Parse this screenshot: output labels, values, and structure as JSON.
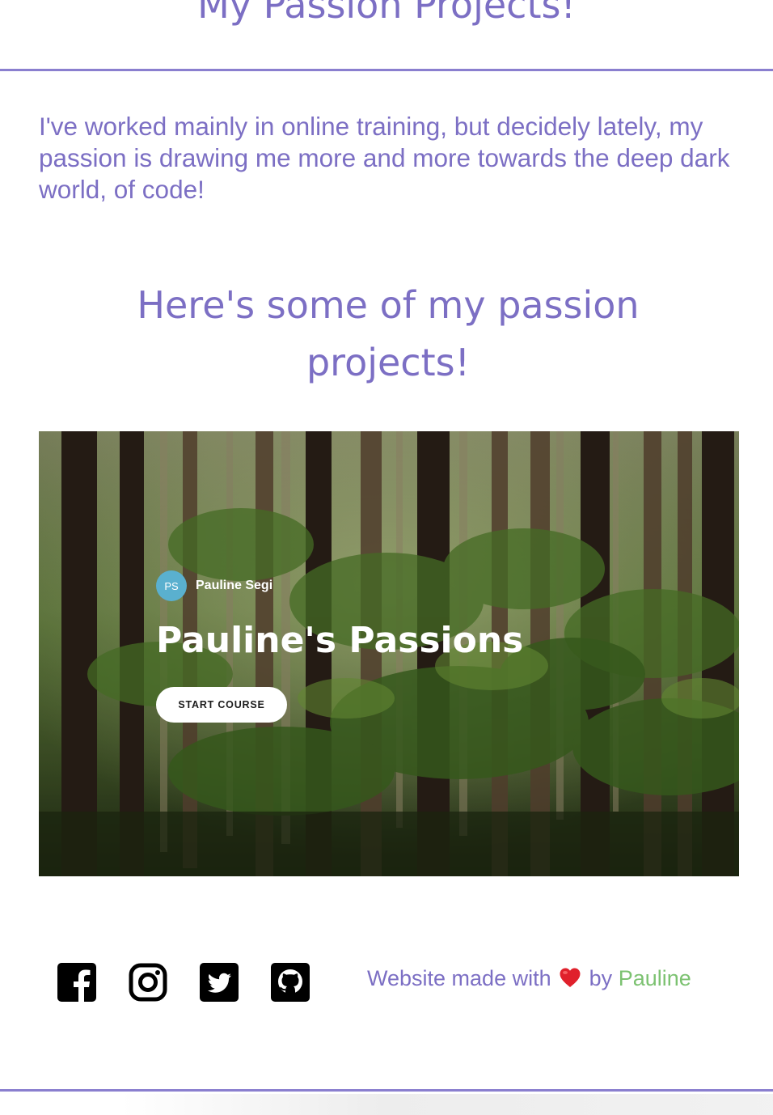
{
  "page": {
    "heading": "My Passion Projects!",
    "intro": "I've worked mainly in online training, but decidely lately, my passion is drawing me more and more towards the deep dark world, of code!",
    "section_heading": "Here's some of my passion projects!"
  },
  "course_card": {
    "avatar_initials": "PS",
    "author": "Pauline Segi",
    "title": "Pauline's Passions",
    "button_label": "START COURSE"
  },
  "footer": {
    "social_icons": [
      "facebook-icon",
      "instagram-icon",
      "twitter-icon",
      "github-icon"
    ],
    "made_with_text": "Website made with",
    "heart_icon": "heart-icon",
    "by_text": "by",
    "author_name": "Pauline"
  },
  "colors": {
    "accent": "#7c6fc4",
    "author_link": "#7cc271",
    "avatar": "#5ab0cf",
    "rule": "#8a7fcf"
  }
}
